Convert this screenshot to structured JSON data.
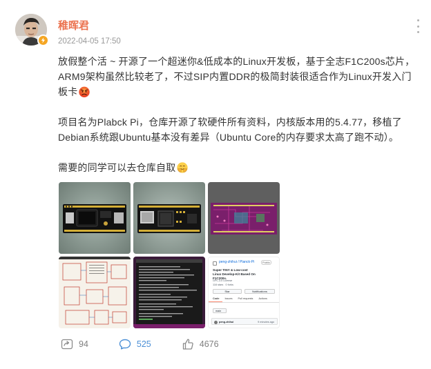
{
  "post": {
    "author": "稚晖君",
    "timestamp": "2022-04-05 17:50",
    "paragraph1": "放假整个活 ~ 开源了一个超迷你&低成本的Linux开发板，基于全志F1C200s芯片，ARM9架构虽然比较老了，不过SIP内置DDR的极简封装很适合作为Linux开发入门板卡",
    "paragraph2": "项目名为Plabck Pi，仓库开源了软硬件所有资料，内核版本用的5.4.77，移植了Debian系统跟Ubuntu基本没有差异（Ubuntu Core的内存要求太高了跑不动）。",
    "paragraph3": "需要的同学可以去仓库自取",
    "emoji1": "angry-face-emoji",
    "emoji2": "laugh-cover-emoji"
  },
  "images": [
    {
      "name": "board-render-front"
    },
    {
      "name": "board-render-back"
    },
    {
      "name": "pcb-layout"
    },
    {
      "name": "schematic"
    },
    {
      "name": "terminal-boot-log"
    },
    {
      "name": "github-repo-page"
    }
  ],
  "github_thumb": {
    "repo": "peng-zhihui / Planck-Pi",
    "badge": "Public",
    "desc": "Super TINY & Low-cost Linux Develop-Kit Based On F1C200s.",
    "license": "GPL-3.0 License",
    "stats": "116 stars   0 forks",
    "star": "Star",
    "notifications": "Notifications",
    "tabs": [
      "Code",
      "Issues",
      "Pull requests",
      "Actions"
    ],
    "branch": "main",
    "commit_user": "peng-zhihui",
    "commit_time": "9 minutes ago"
  },
  "actions": {
    "repost_count": "94",
    "comment_count": "525",
    "like_count": "4676"
  },
  "colors": {
    "author": "#eb7350",
    "comment_accent": "#4b8fd6",
    "verify_badge": "#f5a623"
  }
}
